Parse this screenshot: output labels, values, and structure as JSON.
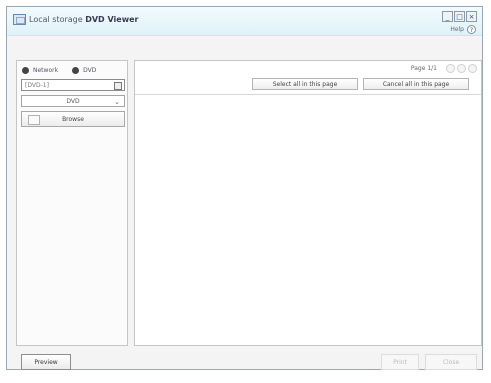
{
  "window": {
    "title_prefix": "Local storage",
    "title_bold": "DVD Viewer",
    "controls": {
      "minimize": "_",
      "restore": "□",
      "close": "×"
    },
    "help_label": "Help",
    "help_icon": "?"
  },
  "left_panel": {
    "radio_options": [
      {
        "label": "Network"
      },
      {
        "label": "DVD"
      }
    ],
    "path_value": "[DVD-1]",
    "select_value": "DVD",
    "browse_label": "Browse"
  },
  "viewer": {
    "page_indicator": "Page 1/1",
    "action_first_label": "Select all in this page",
    "action_second_label": "Cancel all in this page"
  },
  "footer": {
    "left_button_label": "Preview",
    "print_label": "Print",
    "close_label": "Close"
  }
}
